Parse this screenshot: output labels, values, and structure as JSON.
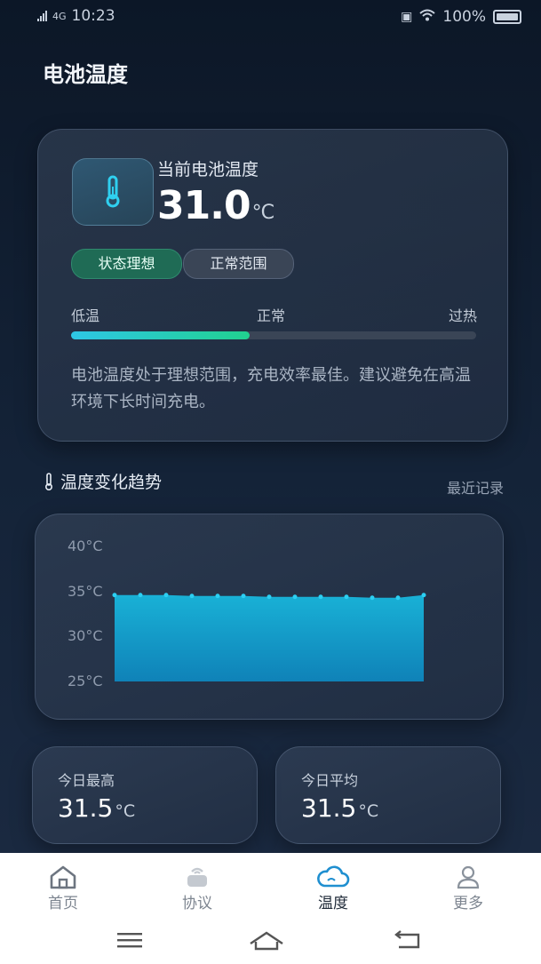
{
  "status_bar": {
    "time": "10:23",
    "network": "4G",
    "battery_percent": "100%"
  },
  "page": {
    "title": "电池温度"
  },
  "current": {
    "label": "当前电池温度",
    "value": "31.0",
    "unit": "°C",
    "status_badge": "状态理想",
    "range_badge": "正常范围",
    "range_labels": [
      "低温",
      "正常",
      "过热"
    ],
    "range_fill": 0.44,
    "description": "电池温度处于理想范围，充电效率最佳。建议避免在高温环境下长时间充电。"
  },
  "trend": {
    "title": "温度变化趋势",
    "link": "最近记录"
  },
  "chart_data": {
    "type": "area",
    "title": "",
    "xlabel": "",
    "ylabel": "",
    "ylim": [
      25,
      40
    ],
    "yticks": [
      "40°C",
      "35°C",
      "30°C",
      "25°C"
    ],
    "x": [
      1,
      2,
      3,
      4,
      5,
      6,
      7,
      8,
      9,
      10,
      11,
      12,
      13
    ],
    "series": [
      {
        "values": [
          34.6,
          34.6,
          34.6,
          34.5,
          34.5,
          34.5,
          34.4,
          34.4,
          34.4,
          34.4,
          34.3,
          34.3,
          34.6
        ]
      }
    ],
    "grid": false,
    "colors": [
      "#19b1d6",
      "#0f82b8"
    ]
  },
  "stats": {
    "max_label": "今日最高",
    "max_value": "31.5",
    "avg_label": "今日平均",
    "avg_value": "31.5",
    "unit": "°C"
  },
  "nav": {
    "items": [
      {
        "label": "首页",
        "icon": "home-icon"
      },
      {
        "label": "协议",
        "icon": "router-icon"
      },
      {
        "label": "温度",
        "icon": "cloud-icon",
        "active": true
      },
      {
        "label": "更多",
        "icon": "user-icon"
      }
    ]
  },
  "colors": {
    "accent_green": "#21d18f",
    "accent_cyan": "#2ec7e6",
    "background": "#0e1a2c"
  }
}
